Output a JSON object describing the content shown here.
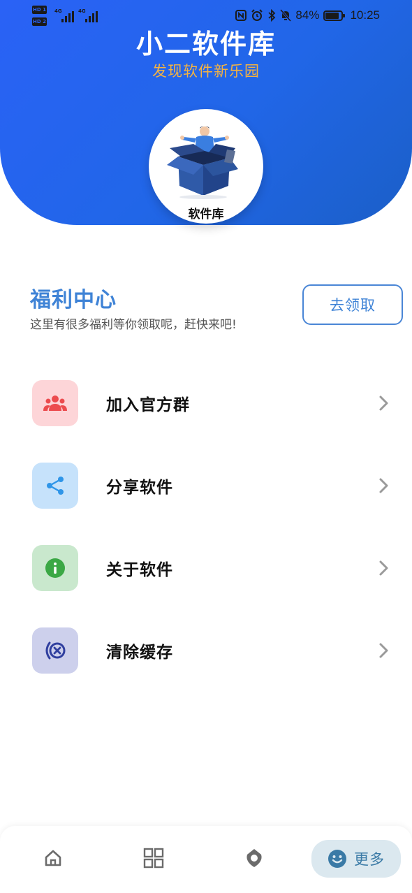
{
  "status_bar": {
    "sim1_badge": "HD 1",
    "sim2_badge": "HD 2",
    "network1": "4G",
    "network2": "4G",
    "battery": "84%",
    "time": "10:25"
  },
  "header": {
    "title": "小二软件库",
    "subtitle": "发现软件新乐园",
    "logo_label": "软件库"
  },
  "welfare": {
    "title": "福利中心",
    "description": "这里有很多福利等你领取呢，赶快来吧!",
    "button_label": "去领取"
  },
  "menu": [
    {
      "label": "加入官方群",
      "icon": "group-icon",
      "bg": "#fdd5d8",
      "fg": "#ec4b4e"
    },
    {
      "label": "分享软件",
      "icon": "share-icon",
      "bg": "#c6e2fb",
      "fg": "#2f95e8"
    },
    {
      "label": "关于软件",
      "icon": "info-icon",
      "bg": "#c9e8cd",
      "fg": "#3ba845"
    },
    {
      "label": "清除缓存",
      "icon": "clear-cache-icon",
      "bg": "#cdd0ec",
      "fg": "#303f9f"
    }
  ],
  "bottom_nav": {
    "items": [
      "home-icon",
      "grid-icon",
      "discover-icon"
    ],
    "active_label": "更多",
    "active_icon": "smile-icon"
  },
  "colors": {
    "header_blue": "#2a62f6",
    "subtitle_orange": "#f5b342",
    "accent_blue": "#3f83d6"
  }
}
